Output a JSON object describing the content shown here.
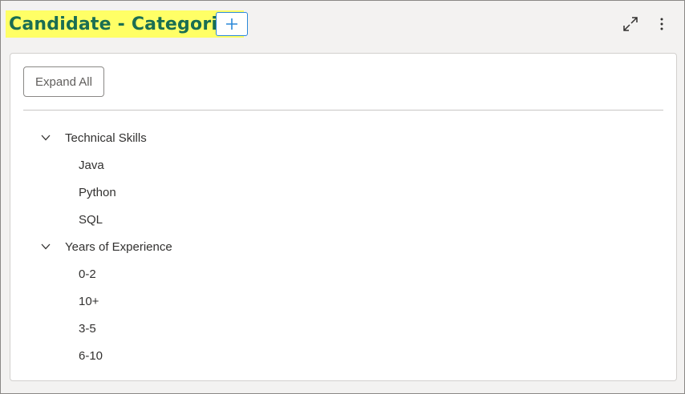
{
  "header": {
    "title": "Candidate - Categories"
  },
  "toolbar": {
    "add_icon": "plus-icon",
    "expand_icon": "expand-arrows-icon",
    "more_icon": "vertical-ellipsis-icon"
  },
  "card": {
    "expand_all_label": "Expand All"
  },
  "tree": [
    {
      "label": "Technical Skills",
      "expanded": true,
      "children": [
        "Java",
        "Python",
        "SQL"
      ]
    },
    {
      "label": "Years of Experience",
      "expanded": true,
      "children": [
        "0-2",
        "10+",
        "3-5",
        "6-10"
      ]
    }
  ],
  "colors": {
    "title_text": "#1a6e52",
    "title_highlight": "#ffff66",
    "accent_border": "#2b88d8"
  }
}
